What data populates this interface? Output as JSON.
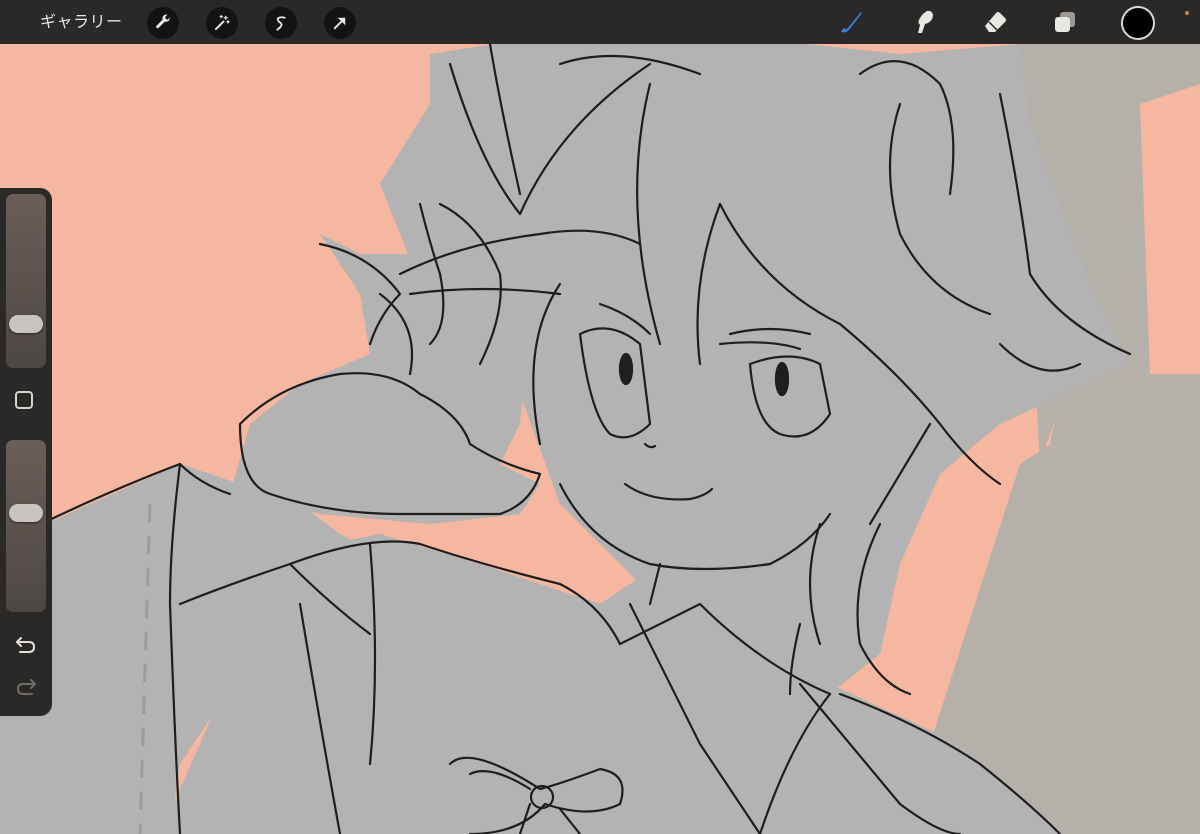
{
  "topbar": {
    "gallery_label": "ギャラリー",
    "left_tools": [
      "wrench-icon",
      "magic-wand-icon",
      "selection-s-icon",
      "move-arrow-icon"
    ],
    "right_tools": [
      "brush-icon",
      "smudge-icon",
      "eraser-icon",
      "layers-icon"
    ],
    "active_tool": "brush-icon",
    "accent_color": "#3a7fe0",
    "current_color": "#000000"
  },
  "sidebar": {
    "brush_size_level": 0.21,
    "opacity_level": 0.59,
    "buttons": [
      "modify-button",
      "undo-button",
      "redo-button"
    ]
  },
  "canvas": {
    "background_color": "#f5b79f",
    "sketch_fill_color": "#b3b3b3",
    "backdrop_shape_color": "#b6b0ab",
    "line_color": "#1e1e1e"
  }
}
